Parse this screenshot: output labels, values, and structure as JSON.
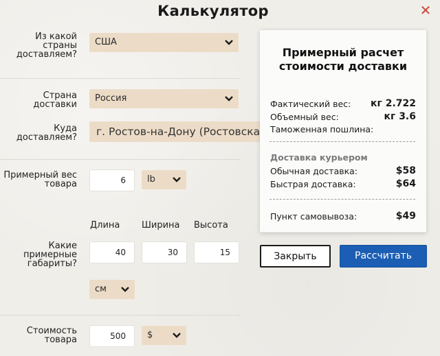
{
  "dialog": {
    "title": "Калькулятор",
    "close_icon": "close-icon"
  },
  "form": {
    "origin": {
      "label": "Из какой страны доставляем?",
      "value": "США"
    },
    "destination_country": {
      "label": "Страна доставки",
      "value": "Россия"
    },
    "destination_place": {
      "label": "Куда доставляем?",
      "value": "г. Ростов-на-Дону (Ростовская"
    },
    "weight": {
      "label": "Примерный вес товара",
      "value": "6",
      "unit": "lb"
    },
    "dimensions": {
      "label": "Какие примерные габариты?",
      "headers": {
        "length": "Длина",
        "width": "Ширина",
        "height": "Высота"
      },
      "length": "40",
      "width": "30",
      "height": "15",
      "unit": "см"
    },
    "price": {
      "label": "Стоимость товара",
      "value": "500",
      "currency": "$"
    }
  },
  "estimate": {
    "title": "Примерный расчет стоимости доставки",
    "actual_weight": {
      "label": "Фактический вес:",
      "value": "кг 2.722"
    },
    "volume_weight": {
      "label": "Объемный вес:",
      "value": "кг 3.6"
    },
    "customs": {
      "label": "Таможенная пошлина:",
      "value": ""
    },
    "courier_section": "Доставка курьером",
    "standard": {
      "label": "Обычная доставка:",
      "value": "$58"
    },
    "express": {
      "label": "Быстрая доставка:",
      "value": "$64"
    },
    "pickup": {
      "label": "Пункт самовывоза:",
      "value": "$49"
    }
  },
  "buttons": {
    "close": "Закрыть",
    "calculate": "Рассчитать"
  },
  "colors": {
    "select_bg": "#ecdcc7",
    "primary": "#1b5eb4",
    "close_icon": "#c9463b"
  }
}
